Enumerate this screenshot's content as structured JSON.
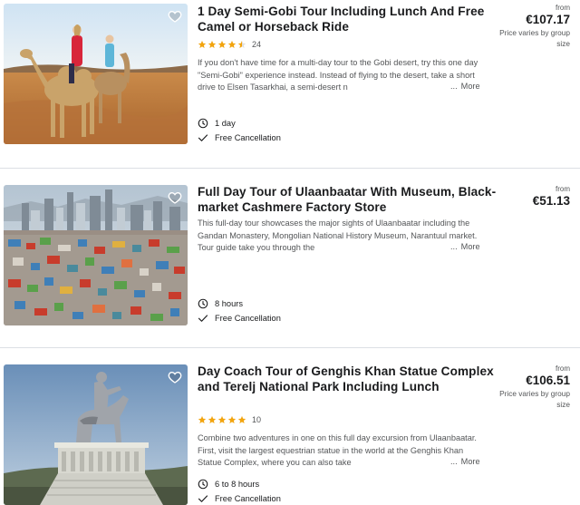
{
  "colors": {
    "star": "#f2a40e",
    "text": "#1a1b1d",
    "muted": "#545658",
    "divider": "#dcdfe4"
  },
  "tours": [
    {
      "title": "1 Day Semi-Gobi Tour Including Lunch And Free Camel or Horseback Ride",
      "rating": 4.5,
      "review_count": "24",
      "description": "If you don't have time for a multi-day tour to the Gobi desert, try this one day \"Semi-Gobi\" experience instead. Instead of flying to the desert, take a short drive to Elsen Tasarkhai, a semi-desert n",
      "ellipsis": "...",
      "more_label": "More",
      "duration": "1 day",
      "cancellation": "Free Cancellation",
      "price_from": "from",
      "price": "€107.17",
      "price_note": "Price varies by group size",
      "image": "camel-riders-in-desert"
    },
    {
      "title": "Full Day Tour of Ulaanbaatar With Museum, Black-market Cashmere Factory Store",
      "rating": null,
      "review_count": "",
      "description": "This full-day tour showcases the major sights of Ulaanbaatar including the Gandan Monastery, Mongolian National History Museum, Narantuul market. Tour guide take you through the",
      "ellipsis": "...",
      "more_label": "More",
      "duration": "8 hours",
      "cancellation": "Free Cancellation",
      "price_from": "from",
      "price": "€51.13",
      "price_note": "",
      "image": "ulaanbaatar-city-view"
    },
    {
      "title": "Day Coach Tour of Genghis Khan Statue Complex and Terelj National Park Including Lunch",
      "rating": 5,
      "review_count": "10",
      "description": "Combine two adventures in one on this full day excursion from Ulaanbaatar. First, visit the largest equestrian statue in the world at the Genghis Khan Statue Complex, where you can also take",
      "ellipsis": "...",
      "more_label": "More",
      "duration": "6 to 8 hours",
      "cancellation": "Free Cancellation",
      "price_from": "from",
      "price": "€106.51",
      "price_note": "Price varies by group size",
      "image": "genghis-khan-equestrian-statue"
    }
  ]
}
